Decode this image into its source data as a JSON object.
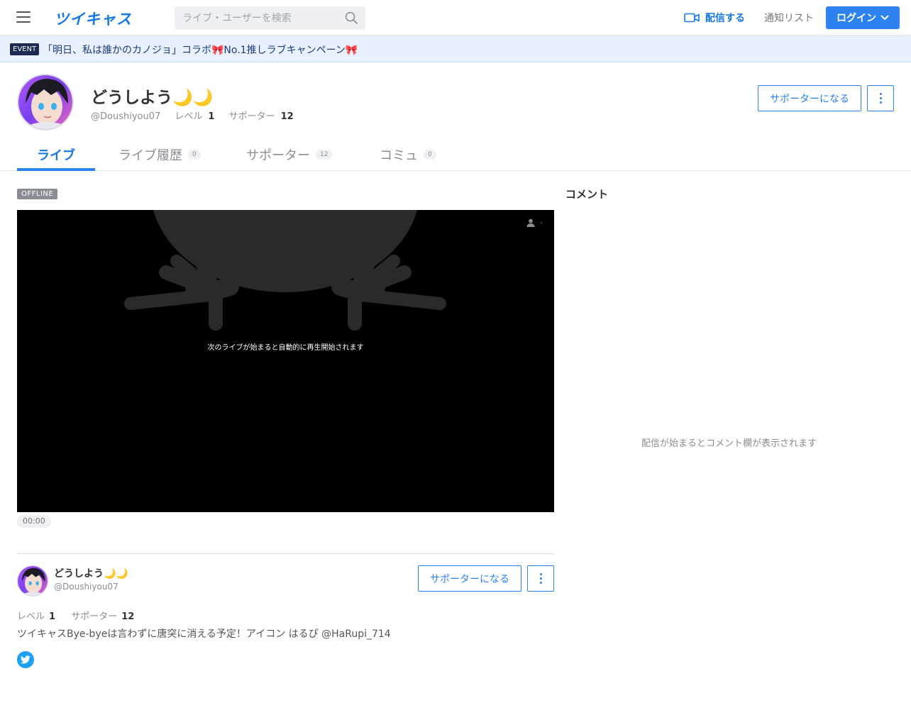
{
  "header": {
    "logo": "ツイキャス",
    "search_placeholder": "ライブ・ユーザーを検索",
    "broadcast_label": "配信する",
    "notify_label": "通知リスト",
    "login_label": "ログイン"
  },
  "event": {
    "badge": "EVENT",
    "text": "「明日、私は誰かのカノジョ」コラボ🎀No.1推しラブキャンペーン🎀"
  },
  "profile": {
    "name": "どうしよう🌙🌙",
    "handle": "@Doushiyou07",
    "level_label": "レベル",
    "level_value": "1",
    "supporter_label": "サポーター",
    "supporter_value": "12",
    "support_button": "サポーターになる"
  },
  "tabs": [
    {
      "label": "ライブ",
      "count": ""
    },
    {
      "label": "ライブ履歴",
      "count": "0"
    },
    {
      "label": "サポーター",
      "count": "12"
    },
    {
      "label": "コミュ",
      "count": "0"
    }
  ],
  "player": {
    "status": "OFFLINE",
    "message": "次のライブが始まると自動的に再生開始されます",
    "viewers": "-",
    "time": "00:00"
  },
  "comments": {
    "title": "コメント",
    "empty": "配信が始まるとコメント欄が表示されます"
  },
  "bio": {
    "text": "ツイキャスBye-byeは言わずに唐突に消える予定！アイコン はるぴ  @HaRupi_714"
  },
  "colors": {
    "accent": "#2b82f0",
    "logo": "#1478e6",
    "event_bg": "#e8f1fd",
    "twitter": "#1da1f2"
  }
}
